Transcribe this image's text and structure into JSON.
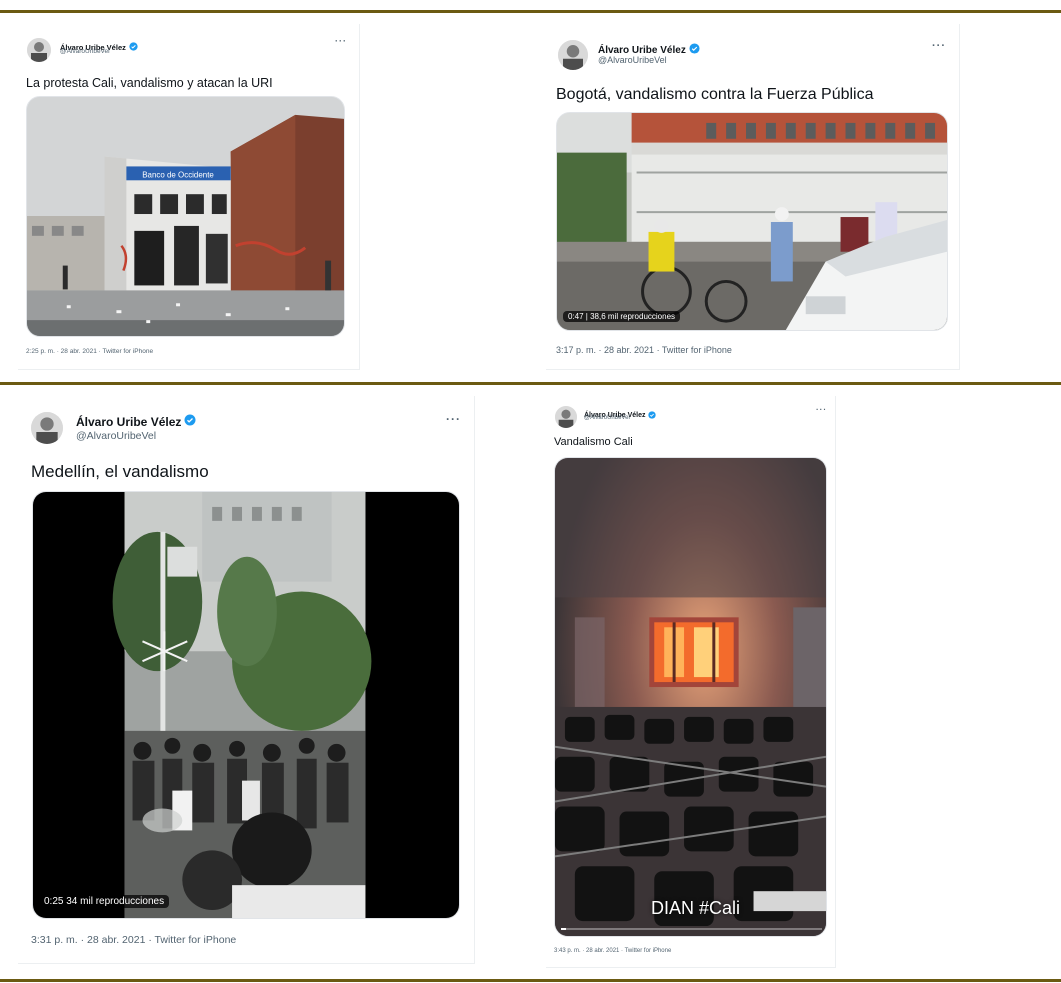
{
  "colors": {
    "rule": "#6b5a12",
    "verified": "#1d9bf0",
    "handle": "#536471",
    "text": "#0f1419"
  },
  "tweets": [
    {
      "author": "Álvaro Uribe Vélez",
      "handle": "@AlvaroUribeVel",
      "more": "···",
      "text": "La protesta Cali, vandalismo y atacan la URI",
      "media_text": "Banco de Occidente",
      "meta": "2:25 p. m. · 28 abr. 2021 · Twitter for iPhone"
    },
    {
      "author": "Álvaro Uribe Vélez",
      "handle": "@AlvaroUribeVel",
      "more": "···",
      "text": "Bogotá, vandalismo contra la Fuerza Pública",
      "video_badge": "0:47 | 38,6 mil reproducciones",
      "meta": "3:17 p. m. · 28 abr. 2021 · Twitter for iPhone"
    },
    {
      "author": "Álvaro Uribe Vélez",
      "handle": "@AlvaroUribeVel",
      "more": "···",
      "text": "Medellín, el vandalismo",
      "video_badge": "0:25  34 mil reproducciones",
      "meta": "3:31 p. m. · 28 abr. 2021 · Twitter for iPhone"
    },
    {
      "author": "Álvaro Uribe Vélez",
      "handle": "@AlvaroUribeVel",
      "more": "···",
      "text": "Vandalismo Cali",
      "video_label": "DIAN #Cali",
      "video_progress": 0.02,
      "meta": "3:43 p. m. · 28 abr. 2021 · Twitter for iPhone"
    }
  ]
}
